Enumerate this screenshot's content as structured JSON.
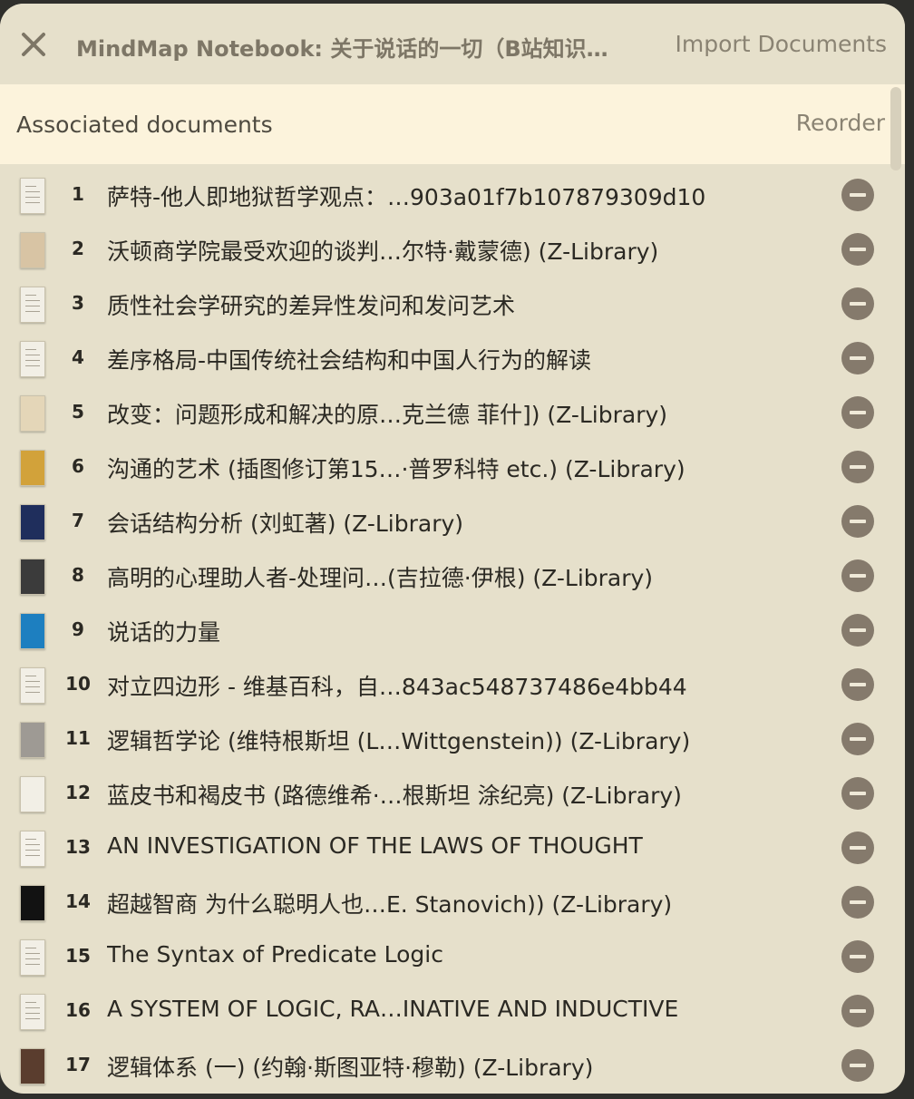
{
  "header": {
    "title": "MindMap Notebook: 关于说话的一切（B站知识…",
    "import_label": "Import Documents",
    "close_icon": "close-icon"
  },
  "associated": {
    "title": "Associated documents",
    "reorder_label": "Reorder"
  },
  "colors": {
    "panel_bg": "#e6e0cb",
    "header_bar_bg": "#fcf3dc",
    "remove_button": "#857a6c",
    "text": "#2b2923",
    "muted_text": "#7d7666"
  },
  "documents": [
    {
      "num": "1",
      "title": "萨特-他人即地狱哲学观点：…903a01f7b107879309d10",
      "thumb_icon": "document-page-icon",
      "thumb_color": "#f2efe6"
    },
    {
      "num": "2",
      "title": "沃顿商学院最受欢迎的谈判…尔特·戴蒙德) (Z-Library)",
      "thumb_icon": "book-cover-icon",
      "thumb_color": "#d8c4a4"
    },
    {
      "num": "3",
      "title": "质性社会学研究的差异性发问和发问艺术",
      "thumb_icon": "document-page-icon",
      "thumb_color": "#f2efe6"
    },
    {
      "num": "4",
      "title": "差序格局-中国传统社会结构和中国人行为的解读",
      "thumb_icon": "document-page-icon",
      "thumb_color": "#f2efe6"
    },
    {
      "num": "5",
      "title": "改变：问题形成和解决的原…克兰德 菲什]) (Z-Library)",
      "thumb_icon": "book-cover-icon",
      "thumb_color": "#e4d6b8"
    },
    {
      "num": "6",
      "title": "沟通的艺术 (插图修订第15…·普罗科特 etc.) (Z-Library)",
      "thumb_icon": "book-cover-icon",
      "thumb_color": "#d2a23a"
    },
    {
      "num": "7",
      "title": "会话结构分析 (刘虹著) (Z-Library)",
      "thumb_icon": "book-cover-icon",
      "thumb_color": "#1f2e5c"
    },
    {
      "num": "8",
      "title": "高明的心理助人者-处理问…(吉拉德·伊根) (Z-Library)",
      "thumb_icon": "book-cover-icon",
      "thumb_color": "#3b3b3b"
    },
    {
      "num": "9",
      "title": "说话的力量",
      "thumb_icon": "book-cover-icon",
      "thumb_color": "#1d7fc0"
    },
    {
      "num": "10",
      "title": "对立四边形 - 维基百科，自…843ac548737486e4bb44",
      "thumb_icon": "document-page-icon",
      "thumb_color": "#f2efe6"
    },
    {
      "num": "11",
      "title": "逻辑哲学论 (维特根斯坦 (L…Wittgenstein)) (Z-Library)",
      "thumb_icon": "book-cover-icon",
      "thumb_color": "#9e9a94"
    },
    {
      "num": "12",
      "title": "蓝皮书和褐皮书 (路德维希·…根斯坦 涂纪亮) (Z-Library)",
      "thumb_icon": "book-cover-icon",
      "thumb_color": "#f2efe6"
    },
    {
      "num": "13",
      "title": "AN INVESTIGATION OF THE LAWS OF THOUGHT",
      "thumb_icon": "document-page-icon",
      "thumb_color": "#f5f2ea"
    },
    {
      "num": "14",
      "title": "超越智商 为什么聪明人也…E. Stanovich)) (Z-Library)",
      "thumb_icon": "book-cover-icon",
      "thumb_color": "#121212"
    },
    {
      "num": "15",
      "title": "The Syntax of Predicate Logic",
      "thumb_icon": "document-page-icon",
      "thumb_color": "#f2efe6"
    },
    {
      "num": "16",
      "title": "A SYSTEM OF LOGIC, RA…INATIVE AND INDUCTIVE",
      "thumb_icon": "document-page-icon",
      "thumb_color": "#f2efe6"
    },
    {
      "num": "17",
      "title": "逻辑体系 (一) (约翰·斯图亚特·穆勒) (Z-Library)",
      "thumb_icon": "book-cover-icon",
      "thumb_color": "#5a3d2e"
    }
  ]
}
